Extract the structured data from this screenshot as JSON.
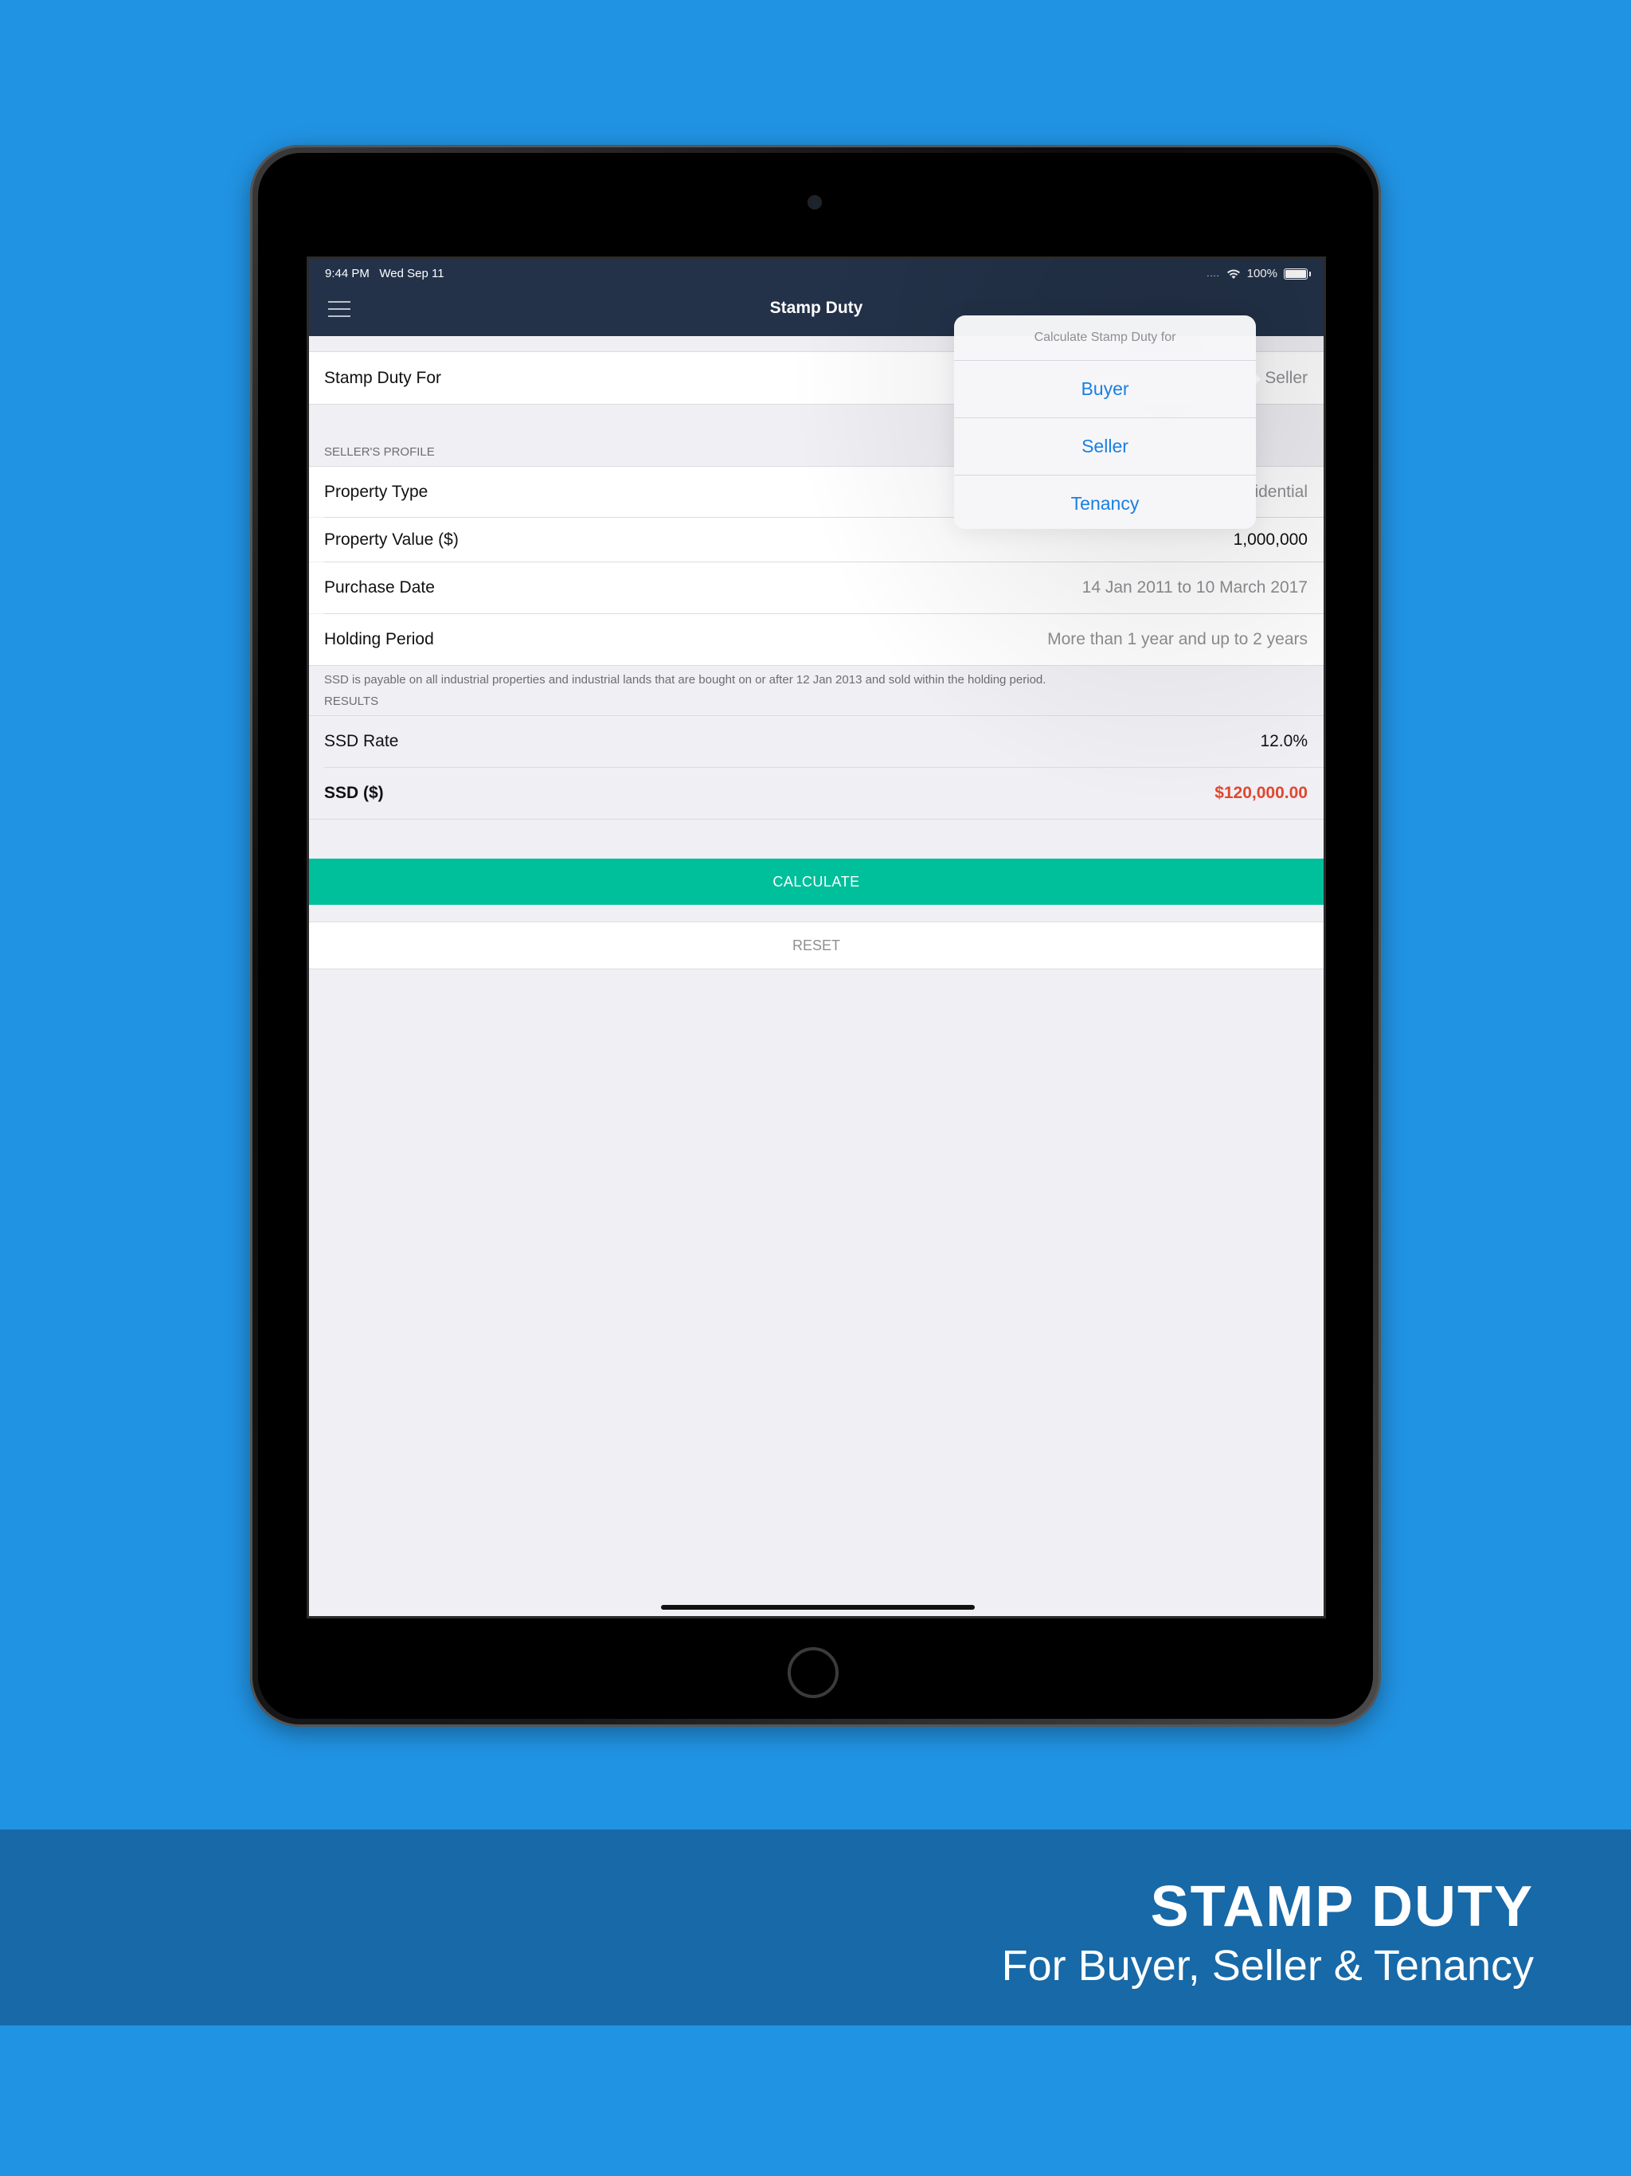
{
  "status_bar": {
    "time": "9:44 PM",
    "date": "Wed Sep 11",
    "battery": "100%"
  },
  "nav": {
    "title": "Stamp Duty"
  },
  "stamp_duty_for": {
    "label": "Stamp Duty For",
    "value": "Seller"
  },
  "sellers_profile": {
    "header": "SELLER'S PROFILE",
    "rows": [
      {
        "label": "Property Type",
        "value": "idential"
      },
      {
        "label": "Property Value ($)",
        "value": "1,000,000"
      },
      {
        "label": "Purchase Date",
        "value": "14 Jan 2011 to 10 March 2017"
      },
      {
        "label": "Holding Period",
        "value": "More than 1 year and up to 2 years"
      }
    ],
    "footnote": "SSD is payable on all industrial properties and industrial lands that are bought on or after 12 Jan 2013 and sold within the holding period."
  },
  "results": {
    "header": "RESULTS",
    "rows": [
      {
        "label": "SSD Rate",
        "value": "12.0%"
      },
      {
        "label": "SSD ($)",
        "value": "$120,000.00"
      }
    ]
  },
  "buttons": {
    "calculate": "CALCULATE",
    "reset": "RESET"
  },
  "popover": {
    "title": "Calculate Stamp Duty for",
    "options": [
      "Buyer",
      "Seller",
      "Tenancy"
    ]
  },
  "banner": {
    "title": "STAMP DUTY",
    "subtitle": "For Buyer, Seller & Tenancy"
  },
  "colors": {
    "background": "#2193e3",
    "nav": "#233249",
    "accent": "#00bf9b",
    "link": "#1a7fe3",
    "ssd": "#e0472f",
    "banner": "#1769a8"
  }
}
